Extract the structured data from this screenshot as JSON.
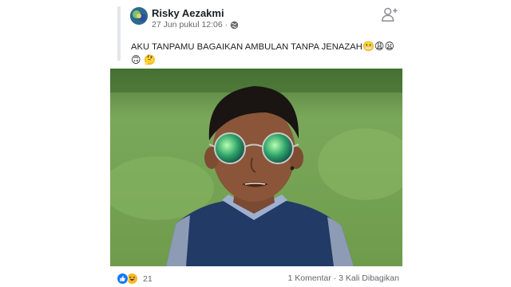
{
  "post": {
    "author": "Risky Aezakmi",
    "date": "27 Jun pukul 12:06",
    "separator": "·",
    "text": "AKU TANPAMU BAGAIKAN AMBULAN TANPA JENAZAH",
    "text_emojis": "😬😩😦🙃 🤔",
    "audience_icon": "globe-icon",
    "add_friend_icon": "add-friend-icon"
  },
  "footer": {
    "reaction_icons": [
      "like-icon",
      "haha-icon"
    ],
    "reaction_count": "21",
    "comments": "1 Komentar",
    "dot": "·",
    "shares": "3 Kali Dibagikan"
  },
  "colors": {
    "like": "#1877f2",
    "haha": "#f7b928",
    "secondary_text": "#65676b"
  }
}
